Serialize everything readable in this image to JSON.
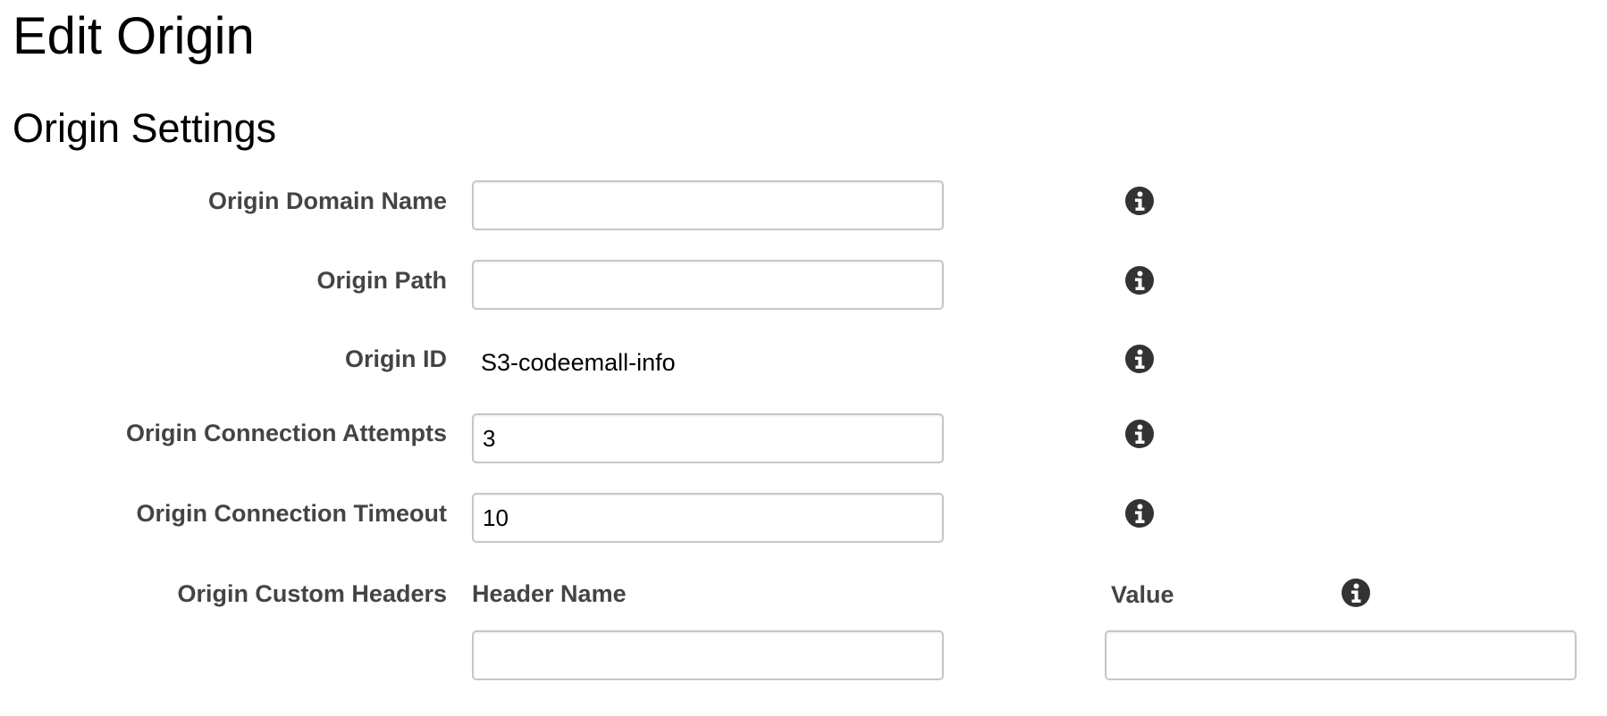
{
  "page": {
    "title": "Edit Origin",
    "section_title": "Origin Settings"
  },
  "fields": {
    "origin_domain_name": {
      "label": "Origin Domain Name",
      "value": ""
    },
    "origin_path": {
      "label": "Origin Path",
      "value": ""
    },
    "origin_id": {
      "label": "Origin ID",
      "value": "S3-codeemall-info"
    },
    "origin_connection_attempts": {
      "label": "Origin Connection Attempts",
      "value": "3"
    },
    "origin_connection_timeout": {
      "label": "Origin Connection Timeout",
      "value": "10"
    }
  },
  "custom_headers": {
    "label": "Origin Custom Headers",
    "header_name_label": "Header Name",
    "value_label": "Value",
    "header_name_value": "",
    "value_value": ""
  },
  "icons": {
    "info": "info-circle-icon"
  },
  "colors": {
    "label": "#444444",
    "input_border": "#c7c7c7",
    "icon": "#333333"
  }
}
